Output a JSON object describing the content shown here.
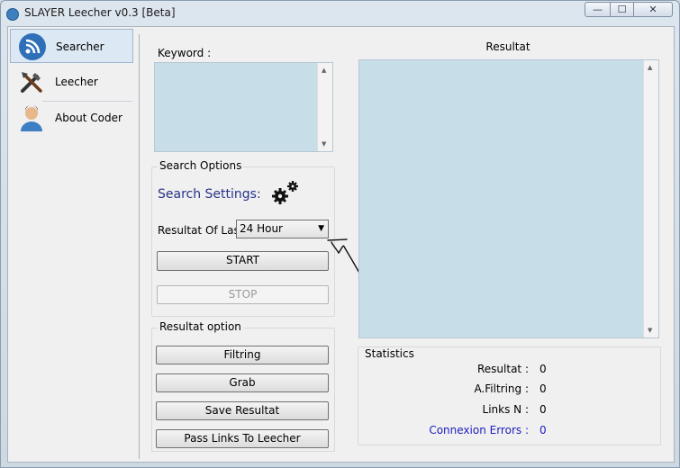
{
  "window": {
    "title": "SLAYER Leecher v0.3 [Beta]",
    "minimize": "—",
    "maximize": "☐",
    "close": "✕"
  },
  "sidebar": {
    "items": [
      {
        "label": "Searcher",
        "icon": "rss-icon"
      },
      {
        "label": "Leecher",
        "icon": "tools-icon"
      },
      {
        "label": "About Coder",
        "icon": "user-icon"
      }
    ]
  },
  "keyword": {
    "label": "Keyword :"
  },
  "search_options": {
    "group_title": "Search Options",
    "settings_heading": "Search Settings:",
    "resultat_label": "Resultat Of Last",
    "resultat_value": "24 Hour",
    "start_label": "START",
    "stop_label": "STOP"
  },
  "resultat_option": {
    "group_title": "Resultat option",
    "buttons": [
      "Filtring",
      "Grab",
      "Save Resultat",
      "Pass Links To Leecher"
    ]
  },
  "results": {
    "label": "Resultat"
  },
  "statistics": {
    "group_title": "Statistics",
    "rows": [
      {
        "label": "Resultat :",
        "value": "0"
      },
      {
        "label": "A.Filtring :",
        "value": "0"
      },
      {
        "label": "Links N :",
        "value": "0"
      },
      {
        "label": "Connexion Errors :",
        "value": "0"
      }
    ]
  },
  "colors": {
    "accent_blue": "#1c1cc0",
    "field_bg": "#c7dde8"
  }
}
